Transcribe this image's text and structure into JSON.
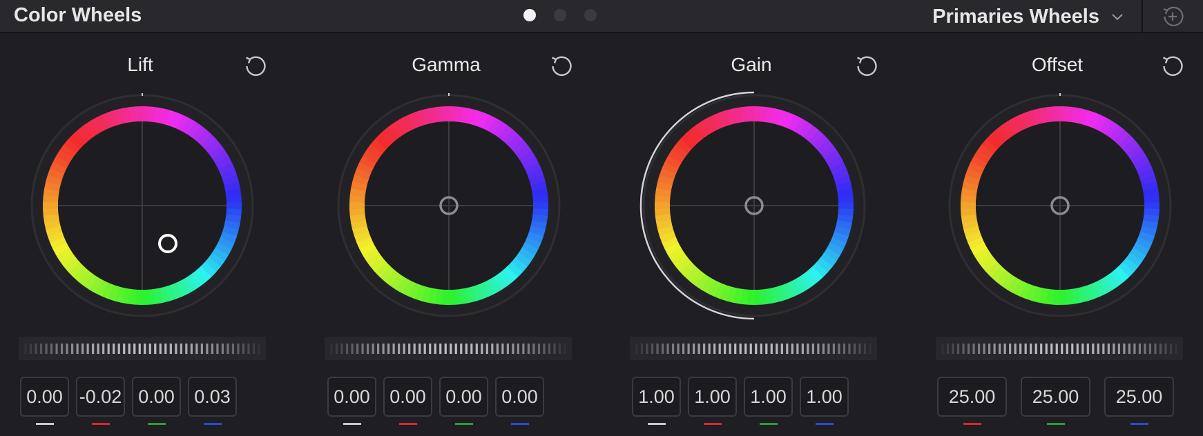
{
  "header": {
    "title": "Color Wheels",
    "mode_label": "Primaries Wheels",
    "page_dots": [
      true,
      false,
      false
    ]
  },
  "wheels": [
    {
      "name": "Lift",
      "values": [
        "0.00",
        "-0.02",
        "0.00",
        "0.03"
      ],
      "channels": [
        "master",
        "red",
        "green",
        "blue"
      ]
    },
    {
      "name": "Gamma",
      "values": [
        "0.00",
        "0.00",
        "0.00",
        "0.00"
      ],
      "channels": [
        "master",
        "red",
        "green",
        "blue"
      ]
    },
    {
      "name": "Gain",
      "values": [
        "1.00",
        "1.00",
        "1.00",
        "1.00"
      ],
      "channels": [
        "master",
        "red",
        "green",
        "blue"
      ]
    },
    {
      "name": "Offset",
      "values": [
        "25.00",
        "25.00",
        "25.00"
      ],
      "channels": [
        "red",
        "green",
        "blue"
      ]
    }
  ],
  "channel_colors": {
    "master": "#c8c8c8",
    "red": "#d8262c",
    "green": "#2f9a3a",
    "blue": "#2b4ad8"
  },
  "icons": {
    "reset": "reset-icon",
    "dropdown": "chevron-down-icon",
    "header_reset": "reset-all-icon"
  }
}
